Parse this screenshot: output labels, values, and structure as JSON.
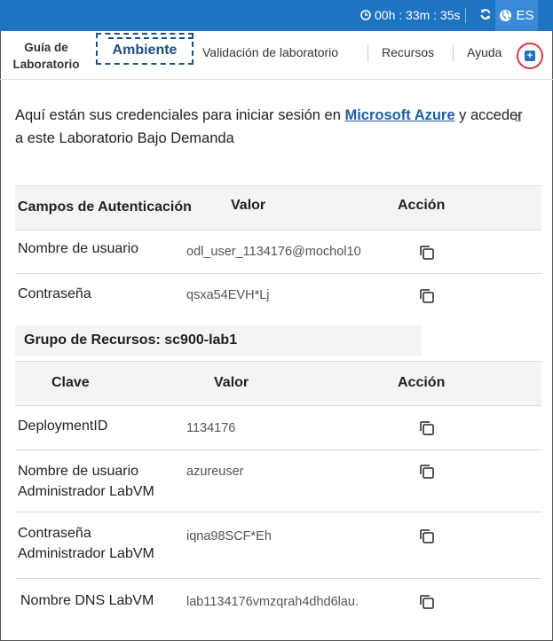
{
  "topbar": {
    "timer": "00h : 33m : 35s",
    "language": "ES",
    "accent_color": "#1e73c2"
  },
  "tabs": {
    "guia": "Guía de Laboratorio",
    "ambiente": "Ambiente",
    "validacion": "Validación de laboratorio",
    "recursos": "Recursos",
    "ayuda": "Ayuda"
  },
  "intro": {
    "before": "Aquí están sus credenciales para iniciar sesión en ",
    "link": "Microsoft Azure",
    "after": " y acceder a este Laboratorio Bajo Demanda",
    "stray": "d"
  },
  "auth_table": {
    "headers": [
      "Campos de Autenticación",
      "Valor",
      "Acción"
    ],
    "rows": [
      {
        "field": "Nombre de usuario",
        "value": "odl_user_1134176@mochol10"
      },
      {
        "field": "Contraseña",
        "value": "qsxa54EVH*Lj"
      }
    ]
  },
  "resource_group": {
    "title": "Grupo de Recursos: sc900-lab1",
    "headers": [
      "Clave",
      "Valor",
      "Acción"
    ],
    "rows": [
      {
        "field": "DeploymentID",
        "value": "1134176"
      },
      {
        "field": "Nombre de usuario Administrador LabVM",
        "value": "azureuser"
      },
      {
        "field": "Contraseña Administrador LabVM",
        "value": "iqna98SCF*Eh"
      },
      {
        "field": "Nombre DNS LabVM",
        "value": "lab1134176vmzqrah4dhd6lau."
      }
    ]
  }
}
